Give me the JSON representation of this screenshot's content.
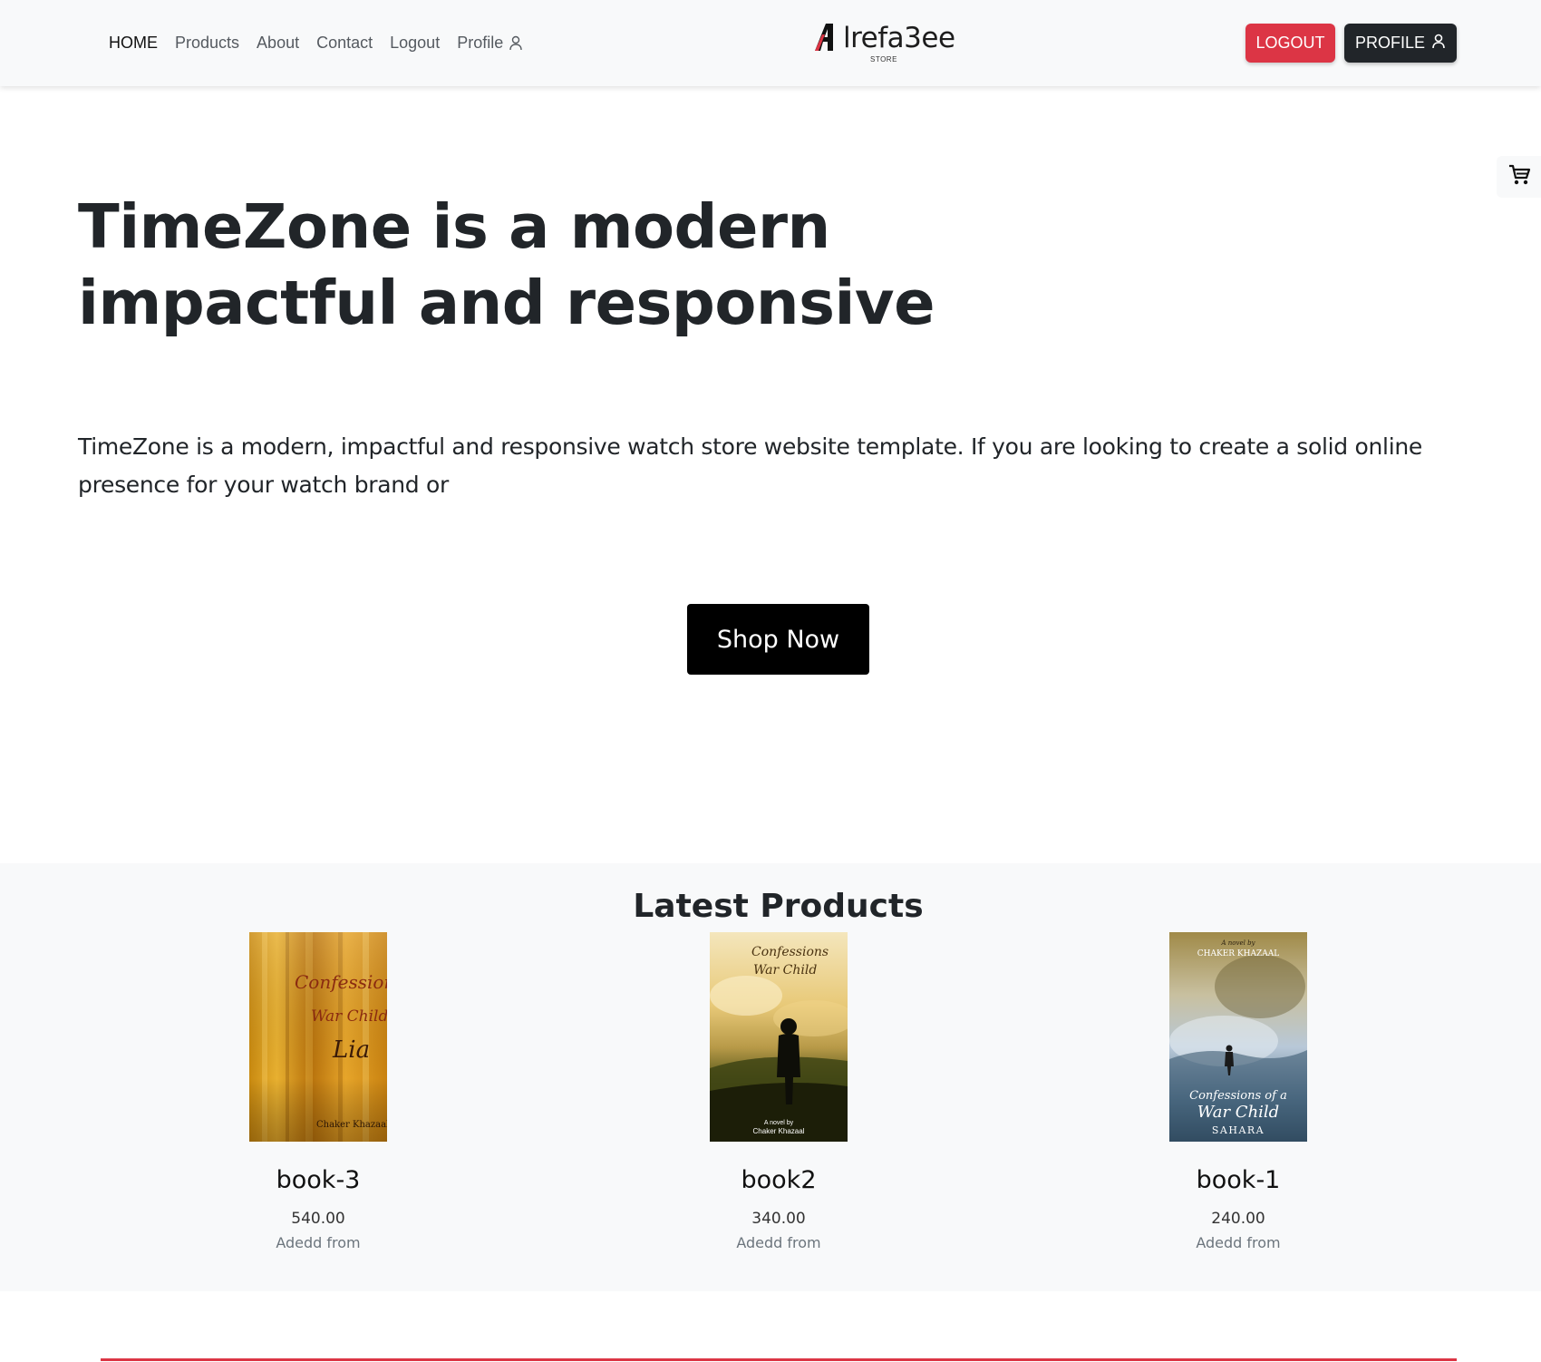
{
  "nav": {
    "links": [
      {
        "label": "HOME",
        "active": true
      },
      {
        "label": "Products"
      },
      {
        "label": "About"
      },
      {
        "label": "Contact"
      },
      {
        "label": "Logout"
      },
      {
        "label": "Profile",
        "icon": "user-icon"
      }
    ]
  },
  "brand": {
    "name": "lrefa3ee",
    "initial": "A",
    "sub": "STORE",
    "accent_color": "#dc3545"
  },
  "actions": {
    "logout_label": "LOGOUT",
    "profile_label": "PROFILE",
    "profile_icon": "user-icon",
    "logout_color": "#dc3545",
    "profile_color": "#212529"
  },
  "cart": {
    "icon": "cart-icon"
  },
  "hero": {
    "title": "TimeZone is a modern impactful and responsive",
    "description": "TimeZone is a modern, impactful and responsive watch store website template. If you are looking to create a solid online presence for your watch brand or",
    "cta_label": "Shop Now"
  },
  "latest": {
    "title": "Latest Products",
    "products": [
      {
        "name": "book-3",
        "price": "540.00",
        "added": "Adedd from",
        "cover": {
          "title_line1": "Confessions",
          "title_line2": "War Child",
          "title_line3": "Lia",
          "author": "Chaker Khazaal"
        }
      },
      {
        "name": "book2",
        "price": "340.00",
        "added": "Adedd from",
        "cover": {
          "title_line1": "Confessions",
          "title_line2": "War Child",
          "author_line1": "A novel by",
          "author_line2": "Chaker Khazaal"
        }
      },
      {
        "name": "book-1",
        "price": "240.00",
        "added": "Adedd from",
        "cover": {
          "author_line1": "A novel by",
          "author_line2": "CHAKER KHAZAAL",
          "title_line1": "Confessions of a",
          "title_line2": "War Child",
          "subtitle": "SAHARA"
        }
      }
    ]
  }
}
